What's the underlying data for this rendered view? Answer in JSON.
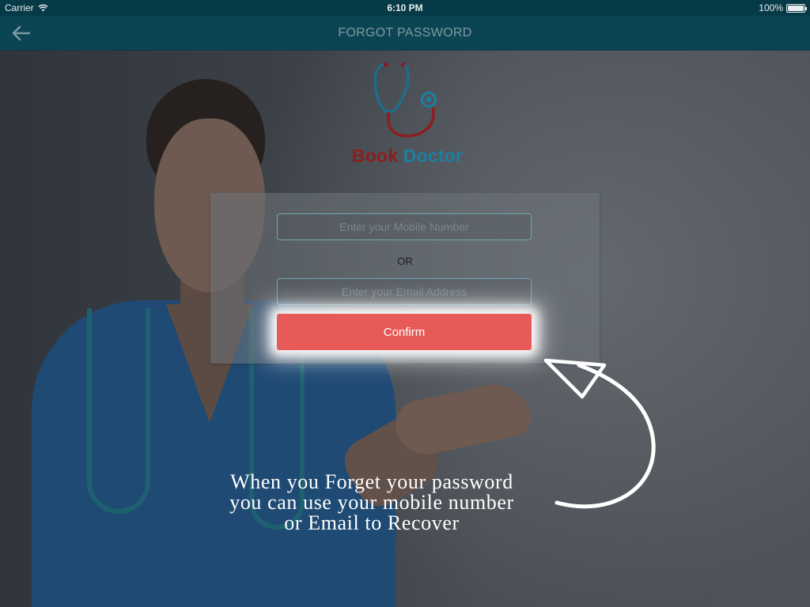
{
  "status_bar": {
    "carrier": "Carrier",
    "time": "6:10 PM",
    "battery": "100%"
  },
  "nav": {
    "back_icon": "arrow-left-icon",
    "title": "FORGOT PASSWORD"
  },
  "logo": {
    "icon": "stethoscope-icon",
    "brand_part1": "Book",
    "brand_part2": "Doctor"
  },
  "form": {
    "mobile_placeholder": "Enter your Mobile Number",
    "or_label": "OR",
    "email_placeholder": "Enter your Email Address",
    "confirm_label": "Confirm"
  },
  "annotation": {
    "line1": "When you Forget your password",
    "line2": "you can use your mobile number",
    "line3": "or Email to Recover"
  },
  "colors": {
    "nav_bar": "#0b4553",
    "confirm_button": "#e85a58",
    "brand_book": "#8a1e21",
    "brand_doctor": "#1c7fa0",
    "field_border": "#6fa8b4"
  }
}
